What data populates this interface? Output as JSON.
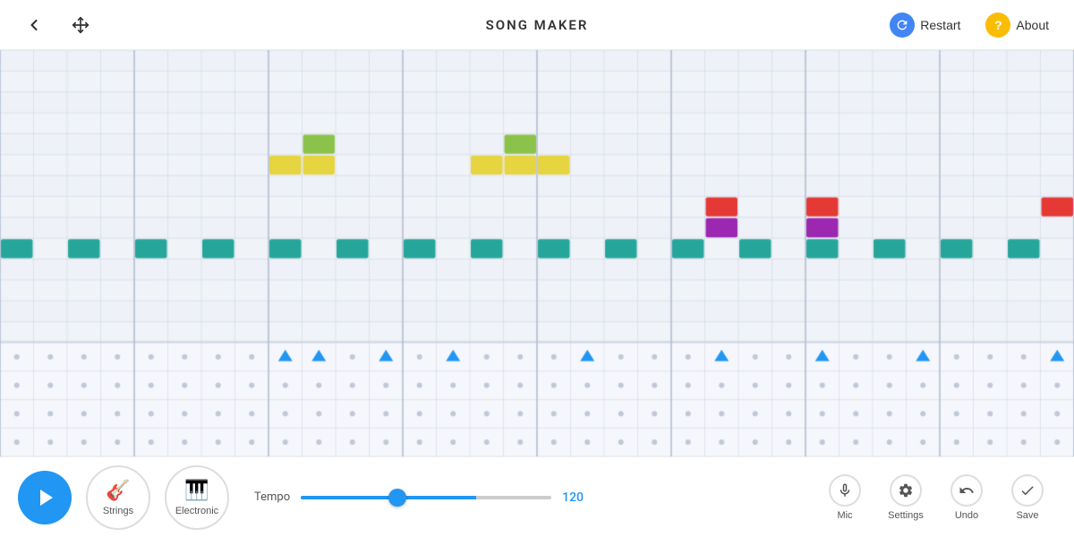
{
  "header": {
    "title": "SONG MAKER",
    "restart_label": "Restart",
    "about_label": "About",
    "back_label": "Back",
    "move_label": "Move"
  },
  "toolbar": {
    "play_label": "Play",
    "instruments": [
      {
        "id": "strings",
        "label": "Strings"
      },
      {
        "id": "electronic",
        "label": "Electronic"
      }
    ],
    "tempo_label": "Tempo",
    "tempo_value": "120",
    "tools": [
      {
        "id": "mic",
        "label": "Mic"
      },
      {
        "id": "settings",
        "label": "Settings"
      },
      {
        "id": "undo",
        "label": "Undo"
      },
      {
        "id": "save",
        "label": "Save"
      }
    ]
  },
  "grid": {
    "cols": 32,
    "melody_rows": 14,
    "beat_rows": 4,
    "accent_color": "#4CAF50",
    "colors": {
      "green": "#4db6ac",
      "yellow": "#e6d440",
      "lime": "#8bc34a",
      "red": "#e53935",
      "purple": "#9c27b0",
      "teal": "#26a69a"
    }
  }
}
